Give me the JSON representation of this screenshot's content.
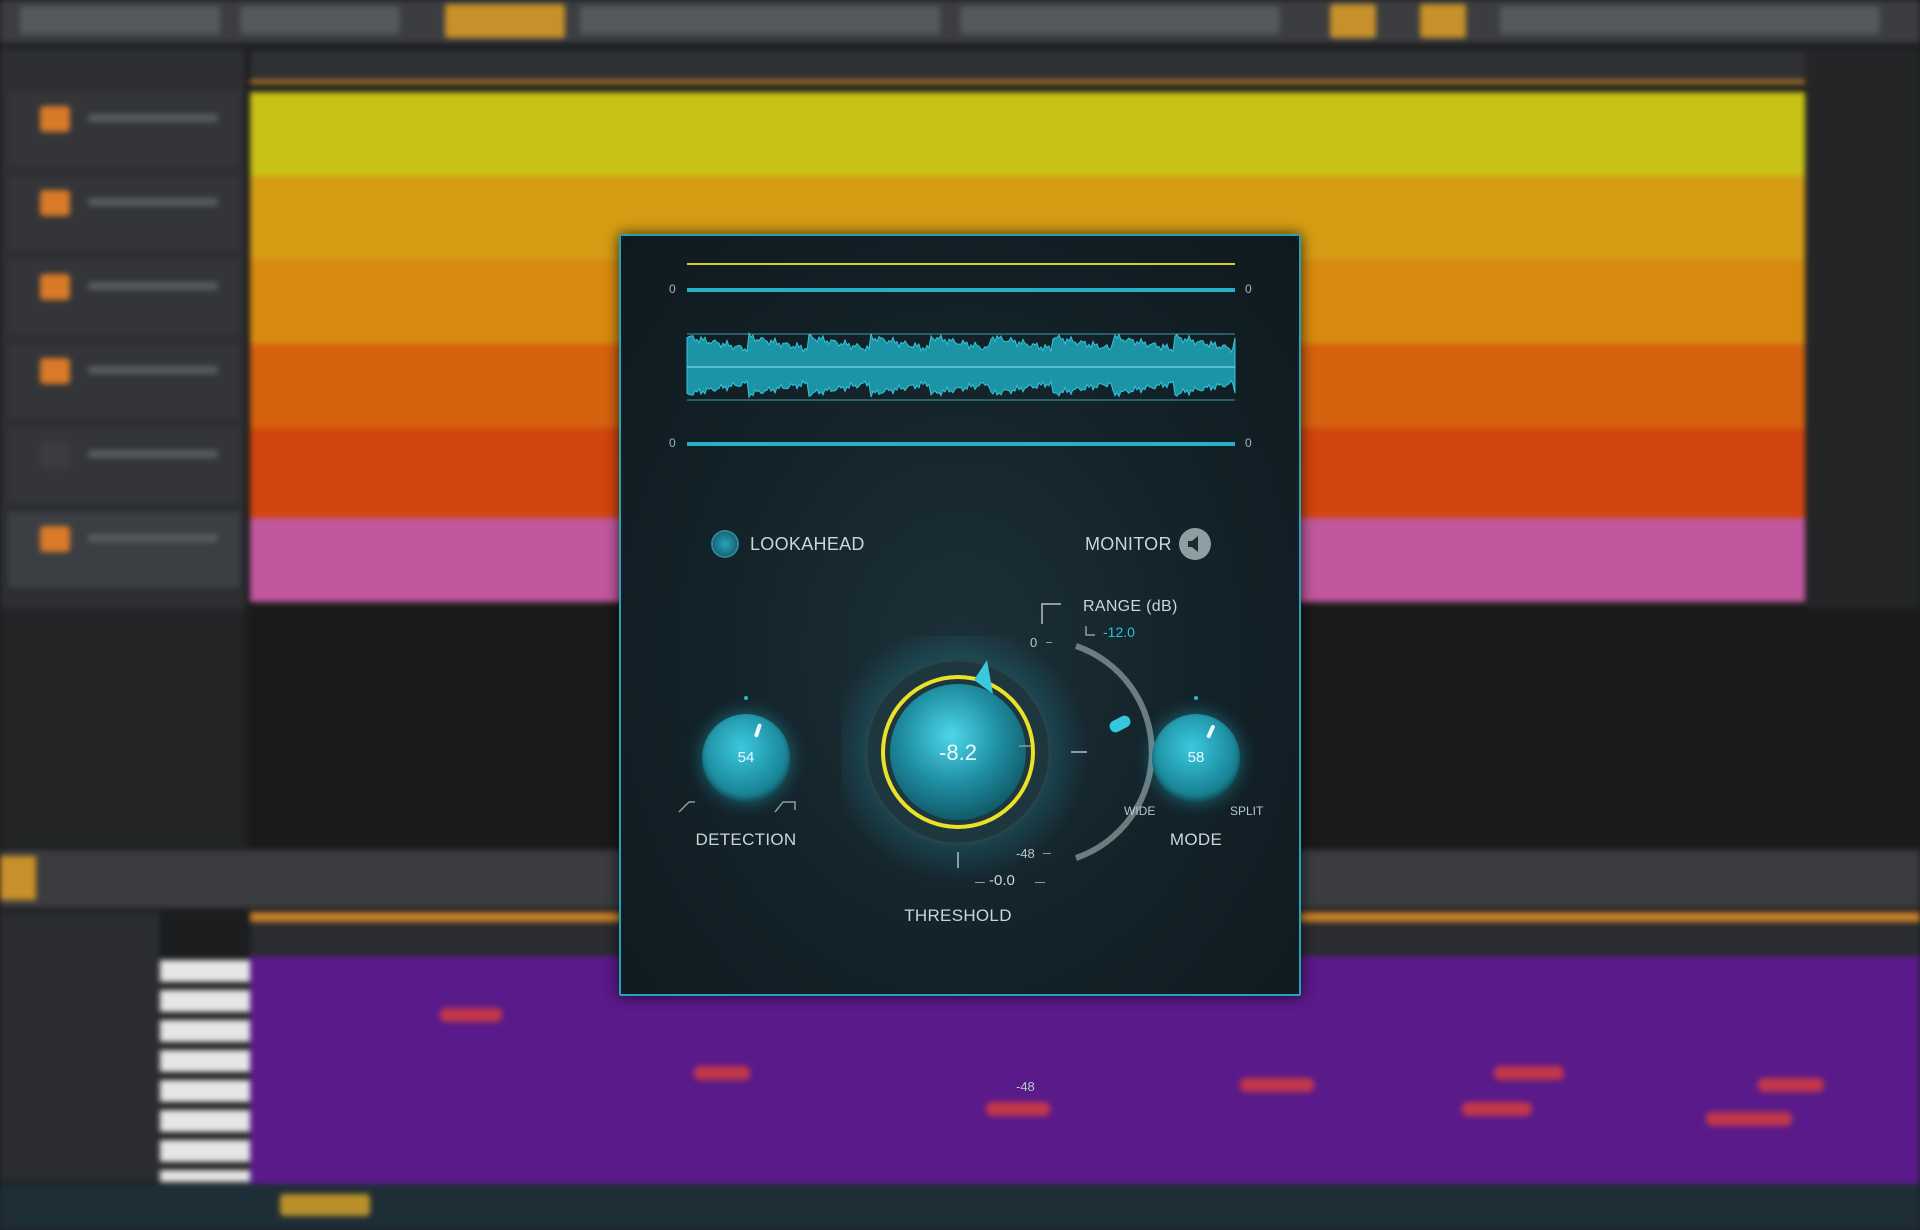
{
  "plugin": {
    "scale": {
      "top_left": "0",
      "top_right": "0",
      "bottom_left": "0",
      "bottom_right": "0"
    },
    "lookahead_label": "LOOKAHEAD",
    "monitor_label": "MONITOR",
    "range": {
      "label": "RANGE (dB)",
      "value": "-12.0",
      "scale_top": "0",
      "scale_bottom": "-48"
    },
    "threshold": {
      "label": "THRESHOLD",
      "value": "-8.2",
      "readout": "-0.0"
    },
    "detection": {
      "label": "DETECTION",
      "value": "54"
    },
    "mode": {
      "label": "MODE",
      "value": "58",
      "left_label": "WIDE",
      "right_label": "SPLIT"
    }
  },
  "colors": {
    "accent": "#29c4dc",
    "threshold_ring": "#f0e020",
    "panel_border": "#2aa0b4",
    "waveform": "#1f98aa"
  }
}
